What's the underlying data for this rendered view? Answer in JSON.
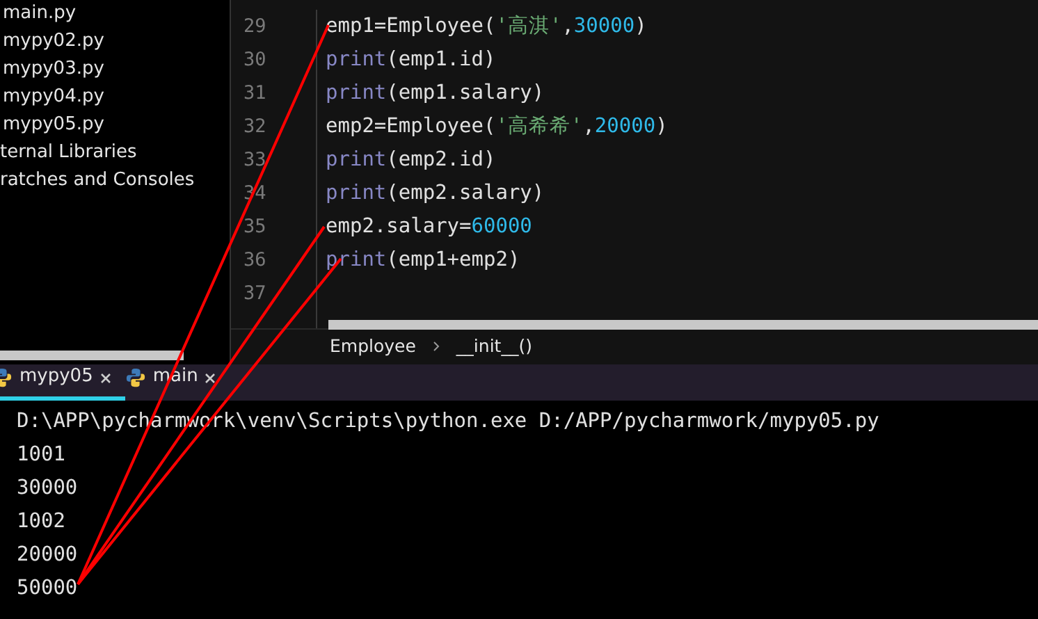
{
  "project_tree": {
    "items": [
      {
        "label": "main.py",
        "kind": "file"
      },
      {
        "label": "mypy02.py",
        "kind": "file"
      },
      {
        "label": "mypy03.py",
        "kind": "file"
      },
      {
        "label": "mypy04.py",
        "kind": "file"
      },
      {
        "label": "mypy05.py",
        "kind": "file"
      },
      {
        "label": "ternal Libraries",
        "kind": "group"
      },
      {
        "label": "ratches and Consoles",
        "kind": "group"
      }
    ]
  },
  "editor": {
    "lines": [
      {
        "number": "29",
        "tokens": [
          {
            "kind": "plain",
            "text": "emp1=Employee("
          },
          {
            "kind": "string",
            "text": "'高淇'"
          },
          {
            "kind": "plain",
            "text": ","
          },
          {
            "kind": "number",
            "text": "30000"
          },
          {
            "kind": "plain",
            "text": ")"
          }
        ]
      },
      {
        "number": "30",
        "tokens": [
          {
            "kind": "builtin",
            "text": "print"
          },
          {
            "kind": "plain",
            "text": "(emp1.id)"
          }
        ]
      },
      {
        "number": "31",
        "tokens": [
          {
            "kind": "builtin",
            "text": "print"
          },
          {
            "kind": "plain",
            "text": "(emp1.salary)"
          }
        ]
      },
      {
        "number": "32",
        "tokens": [
          {
            "kind": "plain",
            "text": "emp2=Employee("
          },
          {
            "kind": "string",
            "text": "'高希希'"
          },
          {
            "kind": "plain",
            "text": ","
          },
          {
            "kind": "number",
            "text": "20000"
          },
          {
            "kind": "plain",
            "text": ")"
          }
        ]
      },
      {
        "number": "33",
        "tokens": [
          {
            "kind": "builtin",
            "text": "print"
          },
          {
            "kind": "plain",
            "text": "(emp2.id)"
          }
        ]
      },
      {
        "number": "34",
        "tokens": [
          {
            "kind": "builtin",
            "text": "print"
          },
          {
            "kind": "plain",
            "text": "(emp2.salary)"
          }
        ]
      },
      {
        "number": "35",
        "tokens": [
          {
            "kind": "plain",
            "text": "emp2.salary="
          },
          {
            "kind": "number",
            "text": "60000"
          }
        ]
      },
      {
        "number": "36",
        "tokens": [
          {
            "kind": "builtin",
            "text": "print"
          },
          {
            "kind": "plain",
            "text": "(emp1+emp2)"
          }
        ]
      },
      {
        "number": "37"
      }
    ],
    "breadcrumb": [
      "Employee",
      "__init__()"
    ]
  },
  "run_tabs": [
    {
      "label": "mypy05",
      "selected": true
    },
    {
      "label": "main",
      "selected": false
    }
  ],
  "console": {
    "lines": [
      "D:\\APP\\pycharmwork\\venv\\Scripts\\python.exe D:/APP/pycharmwork/mypy05.py",
      "1001",
      "30000",
      "1002",
      "20000",
      "50000"
    ]
  }
}
